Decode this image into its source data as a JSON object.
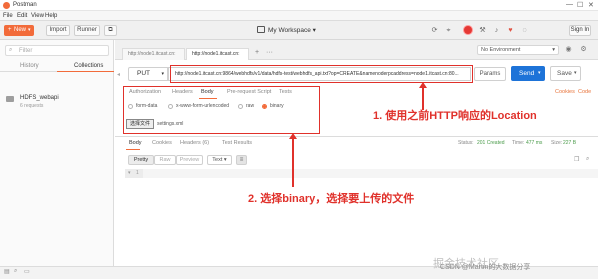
{
  "window": {
    "title": "Postman",
    "minimize": "—",
    "maximize": "☐",
    "close": "✕"
  },
  "menu": [
    "File",
    "Edit",
    "View",
    "Help"
  ],
  "toolbar": {
    "new_label": "New",
    "import_label": "Import",
    "runner_label": "Runner",
    "workspace_label": "My Workspace ▾",
    "sign_in_label": "Sign In"
  },
  "sidebar": {
    "filter_placeholder": "Filter",
    "tabs": [
      "History",
      "Collections"
    ],
    "active_tab": "Collections",
    "collection": {
      "name": "HDFS_webapi",
      "count": "6 requests"
    }
  },
  "request_tabs": [
    {
      "label": "http://node1.itcast.cn:",
      "active": false
    },
    {
      "label": "http://node1.itcast.cn:",
      "active": true
    }
  ],
  "environment": {
    "selected": "No Environment"
  },
  "request": {
    "method": "PUT",
    "url": "http://node1.itcast.cn:9864/webhdfs/v1/data/hdfs-test/webhdfs_api.txt?op=CREATE&namenoderpcaddress=node1.itcast.cn:80...",
    "params_label": "Params",
    "send_label": "Send",
    "save_label": "Save"
  },
  "request_subtabs": [
    "Authorization",
    "Headers",
    "Body",
    "Pre-request Script",
    "Tests"
  ],
  "active_subtab": "Body",
  "links": {
    "cookies": "Cookies",
    "code": "Code"
  },
  "body_modes": [
    {
      "label": "form-data",
      "checked": false
    },
    {
      "label": "x-www-form-urlencoded",
      "checked": false
    },
    {
      "label": "raw",
      "checked": false
    },
    {
      "label": "binary",
      "checked": true
    }
  ],
  "file_picker": {
    "button_label": "选择文件",
    "filename": "settings.xml"
  },
  "response": {
    "tabs": [
      "Body",
      "Cookies",
      "Headers (6)",
      "Test Results"
    ],
    "active_tab": "Body",
    "status_label": "Status:",
    "status_value": "201 Created",
    "time_label": "Time:",
    "time_value": "477 ms",
    "size_label": "Size:",
    "size_value": "227 B",
    "format_buttons": [
      "Pretty",
      "Raw",
      "Preview"
    ],
    "active_format": "Pretty",
    "format_type": "Text ▾",
    "gutter_arrow": "▾",
    "line_number": "1"
  },
  "annotations": {
    "note1": "1. 使用之前HTTP响应的Location",
    "note2": "2. 选择binary，选择要上传的文件"
  },
  "watermark": {
    "main": "掘金技术社区",
    "csdn": "CSDN @Martin的大数据分享"
  },
  "colors": {
    "postman_orange": "#f26b3a",
    "send_blue": "#1d73d8",
    "annotation_red": "#e0312b",
    "status_green": "#4a9b4a"
  }
}
